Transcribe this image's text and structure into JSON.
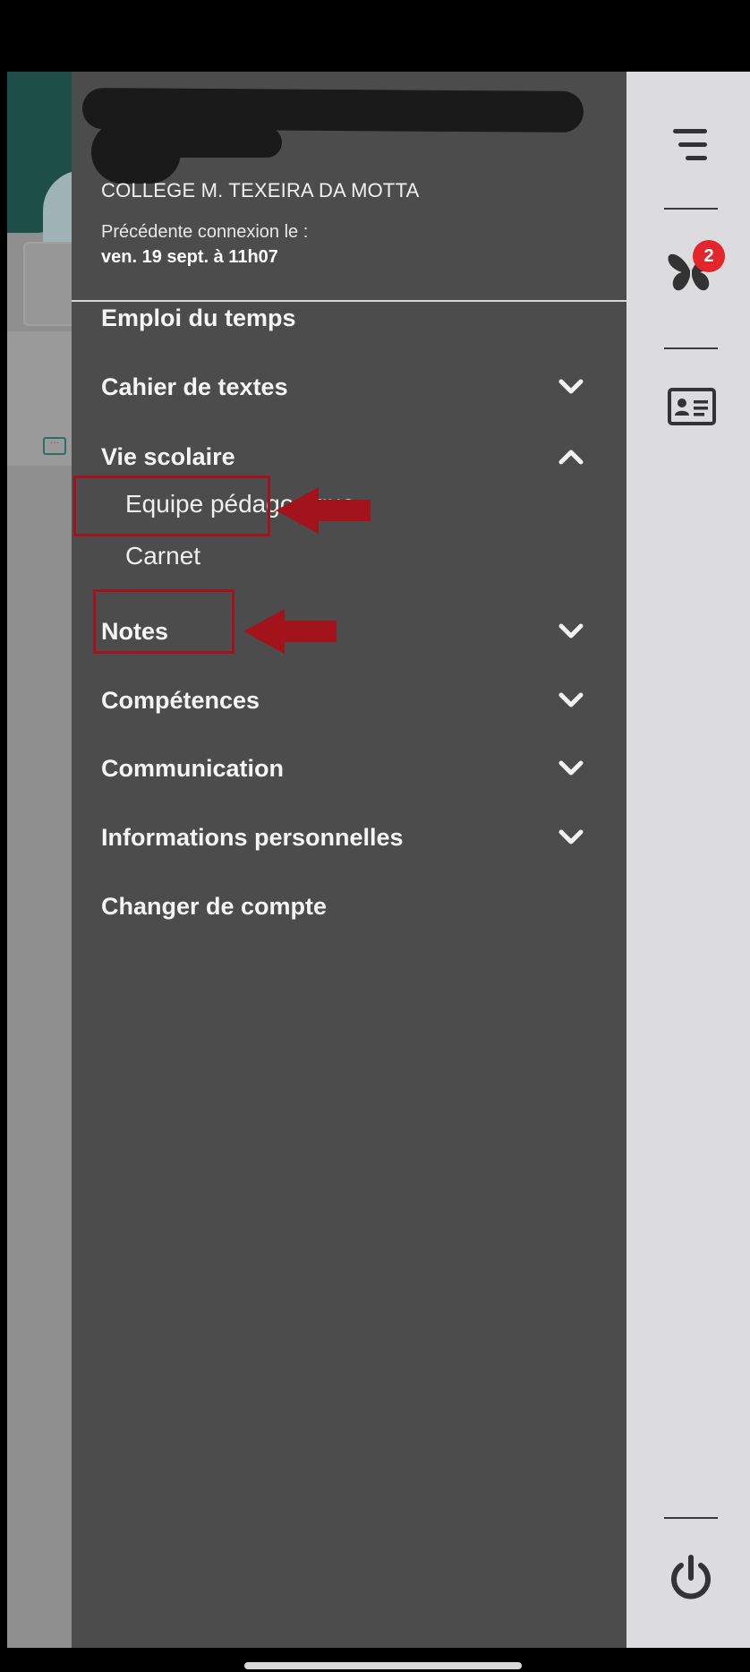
{
  "drawer": {
    "school_name": "COLLEGE M. TEXEIRA DA MOTTA",
    "previous_login_label": "Précédente connexion le :",
    "previous_login_date": "ven. 19 sept. à 11h07"
  },
  "menu": {
    "items": [
      {
        "label": "Emploi du temps",
        "expandable": false
      },
      {
        "label": "Cahier de textes",
        "expandable": true,
        "expanded": false
      },
      {
        "label": "Vie scolaire",
        "expandable": true,
        "expanded": true,
        "children": [
          {
            "label": "Equipe pédagogique"
          },
          {
            "label": "Carnet"
          }
        ]
      },
      {
        "label": "Notes",
        "expandable": true,
        "expanded": false
      },
      {
        "label": "Compétences",
        "expandable": true,
        "expanded": false
      },
      {
        "label": "Communication",
        "expandable": true,
        "expanded": false
      },
      {
        "label": "Informations personnelles",
        "expandable": true,
        "expanded": false
      },
      {
        "label": "Changer de compte",
        "expandable": false
      }
    ]
  },
  "rail": {
    "notification_count": "2",
    "icons": [
      "menu-icon",
      "butterfly-icon",
      "id-card-icon",
      "power-icon"
    ]
  },
  "colors": {
    "drawer_bg": "#4c4c4c",
    "rail_bg": "#dcdcde",
    "badge": "#e2262b",
    "annotation": "#a3131c"
  }
}
